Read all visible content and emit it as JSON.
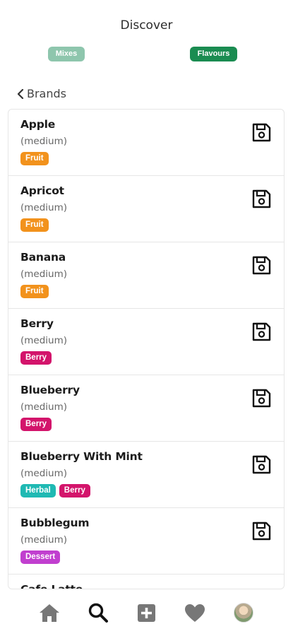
{
  "header": {
    "title": "Discover"
  },
  "toggles": {
    "mixes_label": "Mixes",
    "flavours_label": "Flavours"
  },
  "nav_back": {
    "label": "Brands"
  },
  "colors": {
    "fruit": "#f2921c",
    "berry": "#d3146b",
    "herbal": "#1fb9b3",
    "dessert": "#c13fcf",
    "flavours_active": "#1a8c51",
    "mixes_inactive": "#8ec6ad"
  },
  "items": [
    {
      "name": "Apple",
      "strength": "(medium)",
      "tags": [
        {
          "label": "Fruit",
          "color": "#f2921c"
        }
      ]
    },
    {
      "name": "Apricot",
      "strength": "(medium)",
      "tags": [
        {
          "label": "Fruit",
          "color": "#f2921c"
        }
      ]
    },
    {
      "name": "Banana",
      "strength": "(medium)",
      "tags": [
        {
          "label": "Fruit",
          "color": "#f2921c"
        }
      ]
    },
    {
      "name": "Berry",
      "strength": "(medium)",
      "tags": [
        {
          "label": "Berry",
          "color": "#d3146b"
        }
      ]
    },
    {
      "name": "Blueberry",
      "strength": "(medium)",
      "tags": [
        {
          "label": "Berry",
          "color": "#d3146b"
        }
      ]
    },
    {
      "name": "Blueberry With Mint",
      "strength": "(medium)",
      "tags": [
        {
          "label": "Herbal",
          "color": "#1fb9b3"
        },
        {
          "label": "Berry",
          "color": "#d3146b"
        }
      ]
    },
    {
      "name": "Bubblegum",
      "strength": "(medium)",
      "tags": [
        {
          "label": "Dessert",
          "color": "#c13fcf"
        }
      ]
    },
    {
      "name": "Cafe Latte",
      "strength": "",
      "tags": []
    }
  ],
  "bottom_nav": {
    "items": [
      {
        "icon": "home-icon"
      },
      {
        "icon": "search-icon"
      },
      {
        "icon": "add-icon"
      },
      {
        "icon": "heart-icon"
      },
      {
        "icon": "avatar"
      }
    ]
  }
}
